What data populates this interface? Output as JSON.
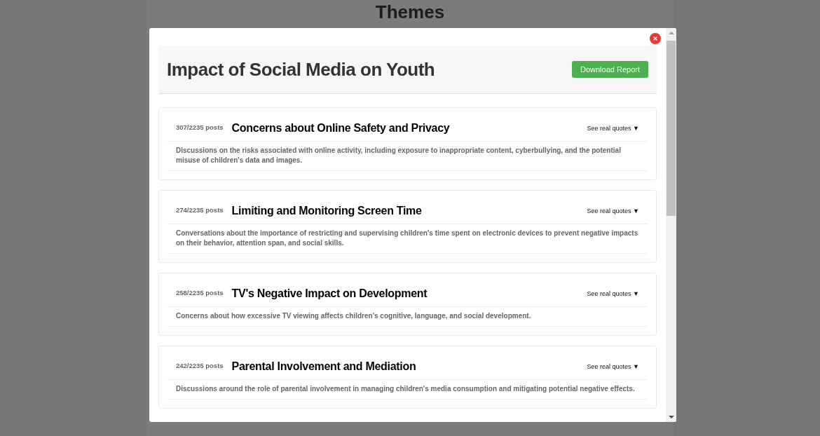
{
  "page": {
    "title": "Themes"
  },
  "modal": {
    "title": "Impact of Social Media on Youth",
    "download_button": "Download Report",
    "themes": [
      {
        "posts": "307/2235 posts",
        "title": "Concerns about Online Safety and Privacy",
        "quotes_toggle": "See real quotes ▼",
        "description": "Discussions on the risks associated with online activity, including exposure to inappropriate content, cyberbullying, and the potential misuse of children's data and images."
      },
      {
        "posts": "274/2235 posts",
        "title": "Limiting and Monitoring Screen Time",
        "quotes_toggle": "See real quotes ▼",
        "description": "Conversations about the importance of restricting and supervising children's time spent on electronic devices to prevent negative impacts on their behavior, attention span, and social skills."
      },
      {
        "posts": "258/2235 posts",
        "title": "TV's Negative Impact on Development",
        "quotes_toggle": "See real quotes ▼",
        "description": "Concerns about how excessive TV viewing affects children's cognitive, language, and social development."
      },
      {
        "posts": "242/2235 posts",
        "title": "Parental Involvement and Mediation",
        "quotes_toggle": "See real quotes ▼",
        "description": "Discussions around the role of parental involvement in managing children's media consumption and mitigating potential negative effects."
      }
    ]
  }
}
